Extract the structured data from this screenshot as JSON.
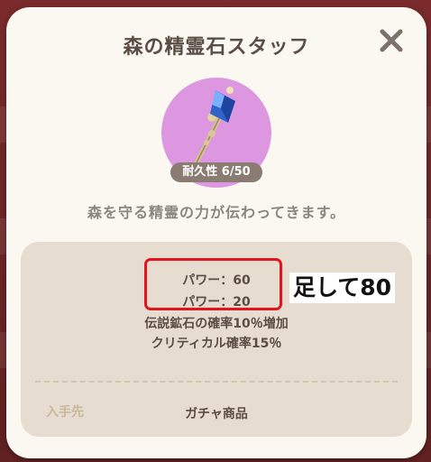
{
  "modal": {
    "title": "森の精霊石スタッフ",
    "close_icon": "close-icon"
  },
  "item": {
    "icon": "staff-icon",
    "circle_color": "#dc97e0",
    "durability": "耐久性 6/50",
    "description": "森を守る精霊の力が伝わってきます。"
  },
  "stats": {
    "power_1": "パワー：60",
    "power_2": "パワー：20",
    "effect_1": "伝説鉱石の確率10％増加",
    "effect_2": "クリティカル確率15％"
  },
  "annotation": {
    "text": "足して80",
    "box_color": "#e4141e"
  },
  "source": {
    "label": "入手先",
    "value": "ガチャ商品"
  }
}
